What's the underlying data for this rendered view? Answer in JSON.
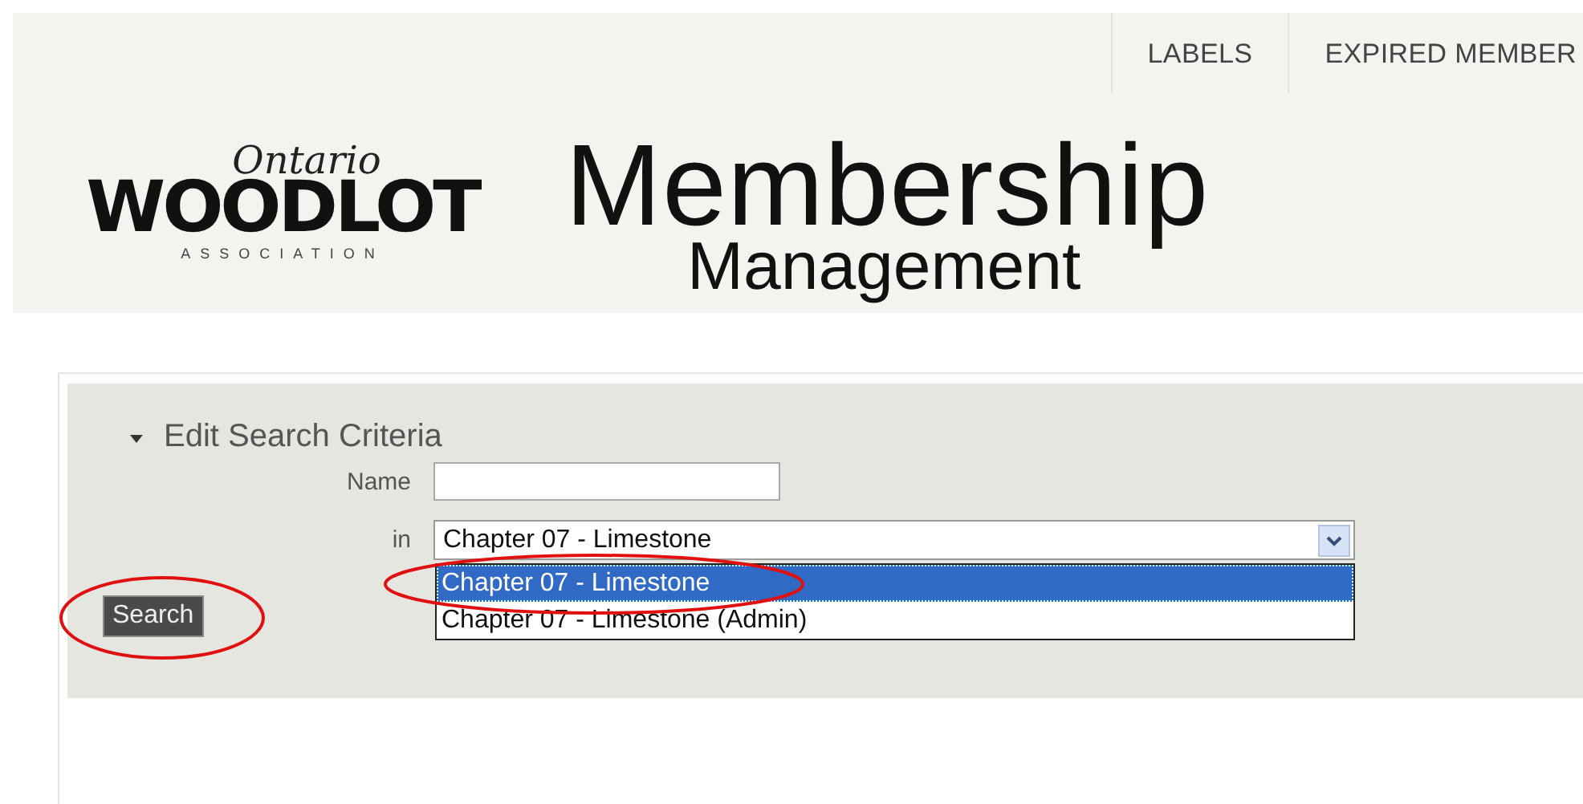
{
  "nav": [
    {
      "label": "LABELS"
    },
    {
      "label": "EXPIRED MEMBER"
    }
  ],
  "logo": {
    "script": "Ontario",
    "name": "WOODLOT",
    "sub": "ASSOCIATION"
  },
  "title": {
    "line1": "Membership",
    "line2": "Management"
  },
  "panel": {
    "heading": "Edit Search Criteria",
    "expanded": true,
    "name_label": "Name",
    "in_label": "in",
    "select": {
      "value": "Chapter 07 - Limestone",
      "open": true,
      "options": [
        {
          "label": "Chapter 07 - Limestone",
          "selected": true
        },
        {
          "label": "Chapter 07 - Limestone (Admin)",
          "selected": false
        }
      ]
    },
    "search_button": "Search"
  }
}
